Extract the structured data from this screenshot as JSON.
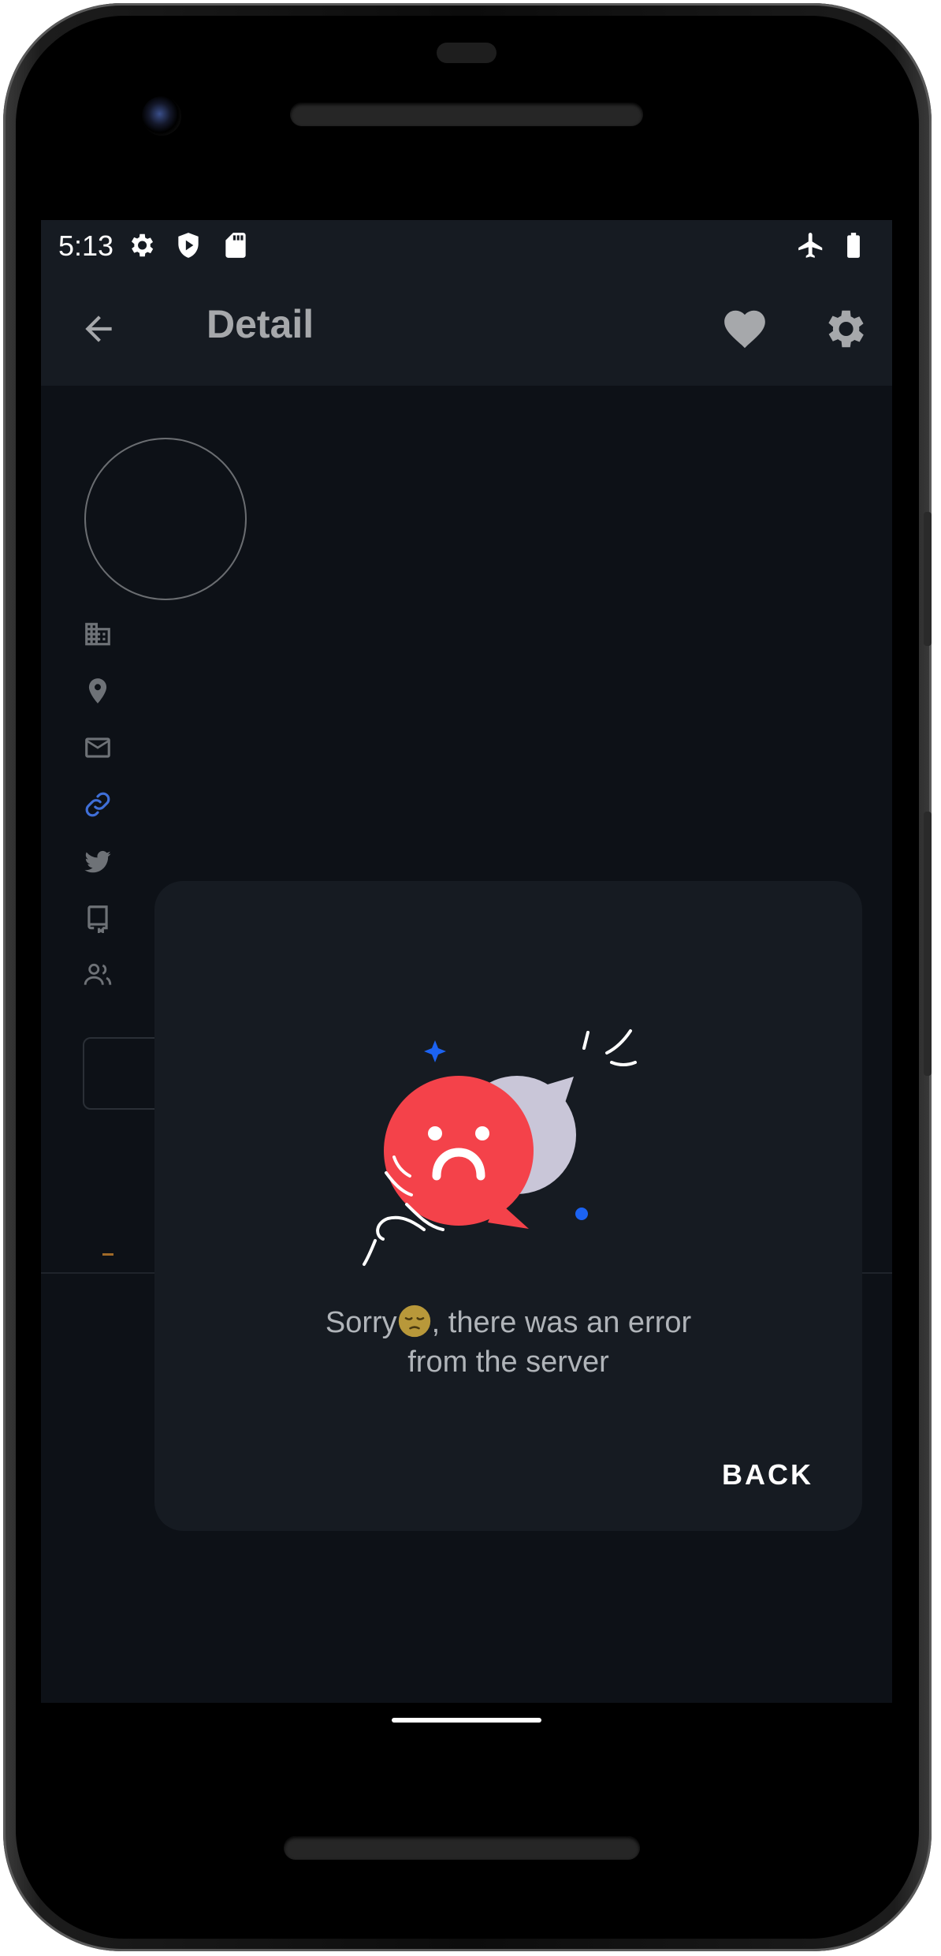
{
  "status_bar": {
    "time": "5:13",
    "icons_left": [
      "gear-icon",
      "shield-play-icon",
      "sd-card-icon"
    ],
    "icons_right": [
      "airplane-icon",
      "battery-icon"
    ]
  },
  "app_bar": {
    "title": "Detail",
    "back_icon": "arrow-left-icon",
    "actions": [
      "heart-icon",
      "gear-icon"
    ]
  },
  "profile_rows": [
    {
      "icon": "company-icon"
    },
    {
      "icon": "location-pin-icon"
    },
    {
      "icon": "email-icon"
    },
    {
      "icon": "link-icon",
      "color": "#3f6fd8"
    },
    {
      "icon": "twitter-icon"
    },
    {
      "icon": "repo-icon"
    },
    {
      "icon": "people-icon"
    }
  ],
  "dialog": {
    "illustration": "sad-chat-bubbles-illustration",
    "message_line1_prefix": "Sorry",
    "message_emoji": "pensive-face-emoji",
    "message_line1_suffix": ", there was an error",
    "message_line2": "from the server",
    "back_label": "BACK"
  },
  "colors": {
    "screen_bg": "#0d1117",
    "surface": "#161b22",
    "accent_red": "#f4424a",
    "bubble_grey": "#c9c6d8",
    "accent_blue": "#1c63f2"
  }
}
